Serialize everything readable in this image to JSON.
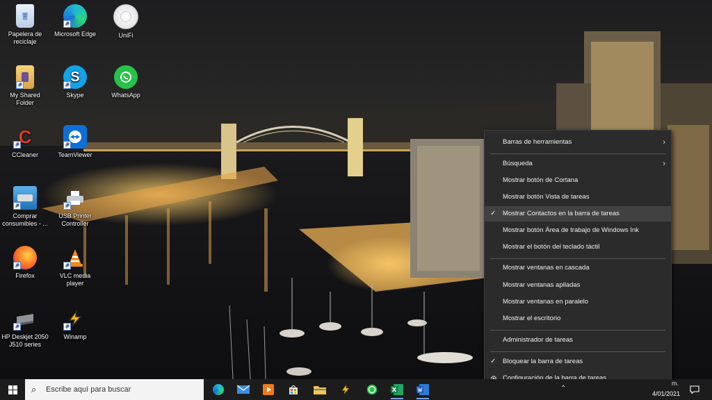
{
  "desktop": {
    "icons": [
      {
        "label": "Papelera de reciclaje",
        "icon": "recycle-bin-icon"
      },
      {
        "label": "Microsoft Edge",
        "icon": "edge-icon"
      },
      {
        "label": "UniFi",
        "icon": "unifi-icon"
      },
      {
        "label": "My Shared Folder",
        "icon": "folder-icon"
      },
      {
        "label": "Skype",
        "icon": "skype-icon"
      },
      {
        "label": "WhatsApp",
        "icon": "whatsapp-icon"
      },
      {
        "label": "CCleaner",
        "icon": "ccleaner-icon"
      },
      {
        "label": "TeamViewer",
        "icon": "teamviewer-icon"
      },
      {
        "label": "Comprar consumibles - ...",
        "icon": "printer-supplies-icon"
      },
      {
        "label": "USB Printer Controller",
        "icon": "printer-icon"
      },
      {
        "label": "Firefox",
        "icon": "firefox-icon"
      },
      {
        "label": "VLC media player",
        "icon": "vlc-icon"
      },
      {
        "label": "HP Deskjet 2050 J510 series",
        "icon": "hp-printer-icon"
      },
      {
        "label": "Winamp",
        "icon": "winamp-icon"
      }
    ]
  },
  "context_menu": {
    "items": [
      {
        "label": "Barras de herramientas",
        "submenu": true,
        "checked": false
      },
      {
        "label": "Búsqueda",
        "submenu": true,
        "checked": false
      },
      {
        "label": "Mostrar botón de Cortana",
        "submenu": false,
        "checked": false
      },
      {
        "label": "Mostrar botón Vista de tareas",
        "submenu": false,
        "checked": false
      },
      {
        "label": "Mostrar Contactos en la barra de tareas",
        "submenu": false,
        "checked": true,
        "highlighted": true
      },
      {
        "label": "Mostrar botón Área de trabajo de Windows Ink",
        "submenu": false,
        "checked": false
      },
      {
        "label": "Mostrar el botón del teclado táctil",
        "submenu": false,
        "checked": false
      },
      {
        "label": "Mostrar ventanas en cascada",
        "submenu": false,
        "checked": false
      },
      {
        "label": "Mostrar ventanas apiladas",
        "submenu": false,
        "checked": false
      },
      {
        "label": "Mostrar ventanas en paralelo",
        "submenu": false,
        "checked": false
      },
      {
        "label": "Mostrar el escritorio",
        "submenu": false,
        "checked": false
      },
      {
        "label": "Administrador de tareas",
        "submenu": false,
        "checked": false
      },
      {
        "label": "Bloquear la barra de tareas",
        "submenu": false,
        "checked": true
      },
      {
        "label": "Configuración de la barra de tareas",
        "submenu": false,
        "checked": false,
        "icon": "gear-icon"
      }
    ],
    "check_glyph": "✓",
    "arrow_glyph": "›"
  },
  "taskbar": {
    "search_placeholder": "Escribe aquí para buscar",
    "apps": [
      "edge-icon",
      "mail-icon",
      "media-player-icon",
      "store-icon",
      "file-explorer-icon",
      "winamp-icon",
      "whatsapp-icon",
      "excel-icon",
      "word-icon"
    ],
    "tray_text": "m.",
    "date": "4/01/2021"
  },
  "colors": {
    "menu_bg": "#2b2b2b",
    "menu_highlight": "#414141",
    "taskbar_bg": "#1c1c1c"
  }
}
